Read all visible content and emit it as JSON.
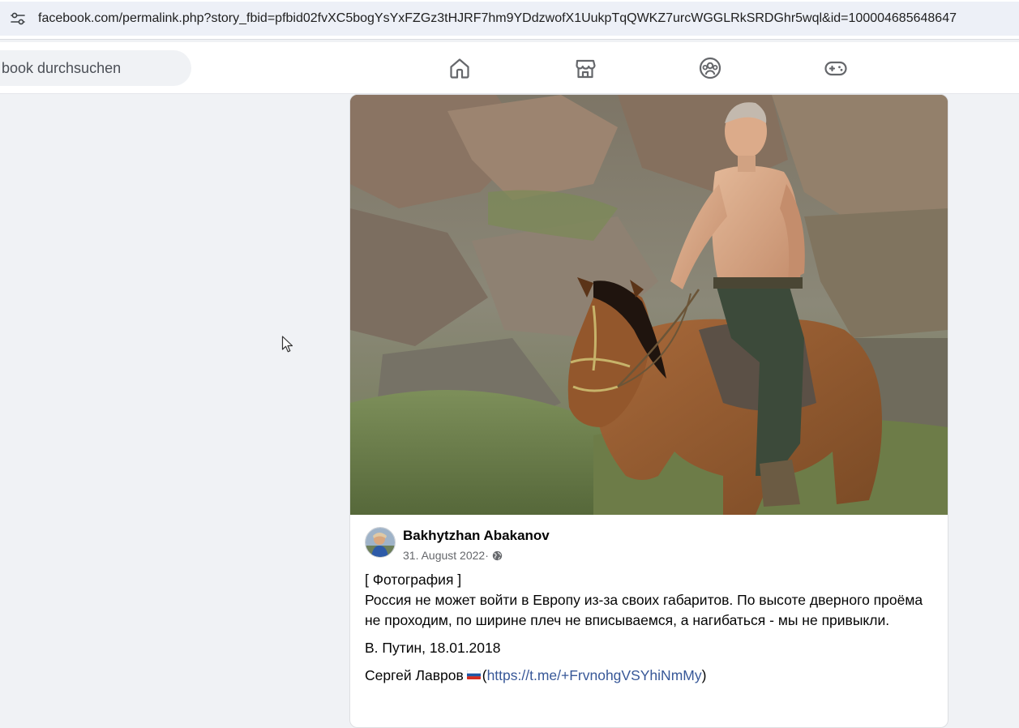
{
  "browser": {
    "url": "facebook.com/permalink.php?story_fbid=pfbid02fvXC5bogYsYxFZGz3tHJRF7hm9YDdzwofX1UukpTqQWKZ7urcWGGLRkSRDGhr5wql&id=100004685648647"
  },
  "nav": {
    "search_placeholder": "book durchsuchen",
    "icons": [
      "home-icon",
      "marketplace-icon",
      "groups-icon",
      "gaming-icon"
    ]
  },
  "post": {
    "author": "Bakhytzhan Abakanov",
    "date": "31. August 2022",
    "separator": " · ",
    "photo_tag": "[ Фотография ]",
    "quote": "Россия не может войти в Европу из-за своих габаритов. По высоте дверного проёма не проходим, по ширине плеч не вписываемся, а нагибаться - мы не привыкли.",
    "attribution": "В. Путин, 18.01.2018",
    "source_name": "Сергей Лавров",
    "open_paren": "(",
    "link_text": "https://t.me/+FrvnohgVSYhiNmMy",
    "close_paren": ")"
  },
  "colors": {
    "page_bg": "#f0f2f5",
    "link": "#385898",
    "meta": "#65676b"
  }
}
